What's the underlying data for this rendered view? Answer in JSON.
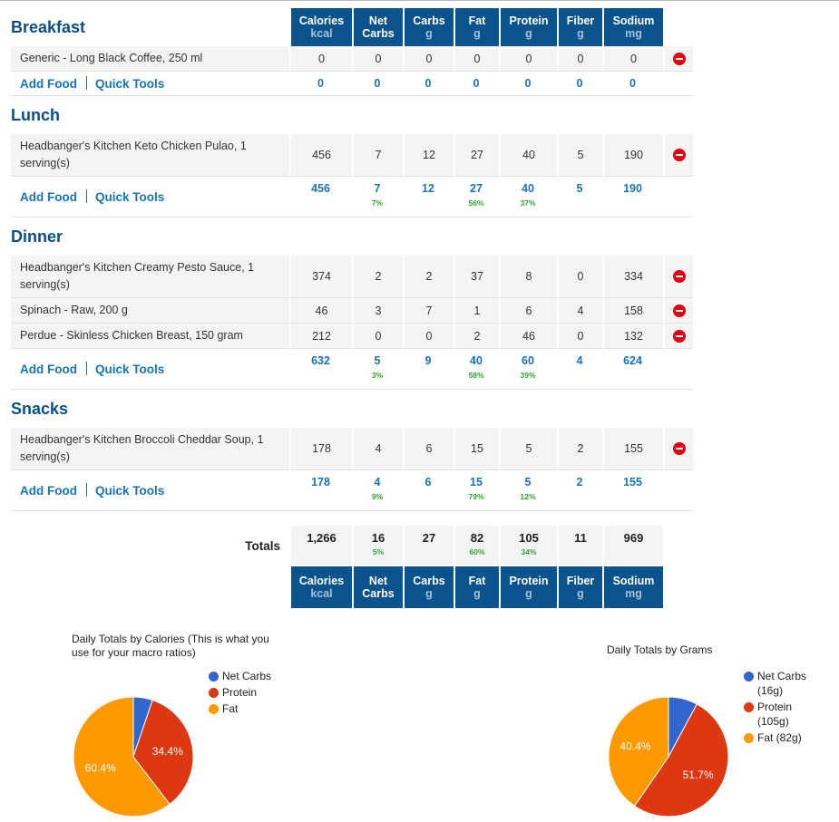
{
  "columns": [
    {
      "name": "Calories",
      "unit": "kcal"
    },
    {
      "name": "Net",
      "unit": "Carbs",
      "unit_style": "white"
    },
    {
      "name": "Carbs",
      "unit": "g"
    },
    {
      "name": "Fat",
      "unit": "g"
    },
    {
      "name": "Protein",
      "unit": "g"
    },
    {
      "name": "Fiber",
      "unit": "g"
    },
    {
      "name": "Sodium",
      "unit": "mg"
    }
  ],
  "links": {
    "add_food": "Add Food",
    "quick_tools": "Quick Tools"
  },
  "meals": [
    {
      "title": "Breakfast",
      "foods": [
        {
          "name": "Generic - Long Black Coffee, 250 ml",
          "values": [
            "0",
            "0",
            "0",
            "0",
            "0",
            "0",
            "0"
          ]
        }
      ],
      "totals": [
        "0",
        "0",
        "0",
        "0",
        "0",
        "0",
        "0"
      ],
      "percents": {
        "net": "",
        "fat": "",
        "protein": ""
      }
    },
    {
      "title": "Lunch",
      "foods": [
        {
          "name": "Headbanger's Kitchen Keto Chicken Pulao, 1 serving(s)",
          "values": [
            "456",
            "7",
            "12",
            "27",
            "40",
            "5",
            "190"
          ]
        }
      ],
      "totals": [
        "456",
        "7",
        "12",
        "27",
        "40",
        "5",
        "190"
      ],
      "percents": {
        "net": "7%",
        "fat": "56%",
        "protein": "37%"
      }
    },
    {
      "title": "Dinner",
      "foods": [
        {
          "name": "Headbanger's Kitchen Creamy Pesto Sauce, 1 serving(s)",
          "values": [
            "374",
            "2",
            "2",
            "37",
            "8",
            "0",
            "334"
          ]
        },
        {
          "name": "Spinach - Raw, 200 g",
          "values": [
            "46",
            "3",
            "7",
            "1",
            "6",
            "4",
            "158"
          ]
        },
        {
          "name": "Perdue - Skinless Chicken Breast, 150 gram",
          "values": [
            "212",
            "0",
            "0",
            "2",
            "46",
            "0",
            "132"
          ]
        }
      ],
      "totals": [
        "632",
        "5",
        "9",
        "40",
        "60",
        "4",
        "624"
      ],
      "percents": {
        "net": "3%",
        "fat": "58%",
        "protein": "39%"
      }
    },
    {
      "title": "Snacks",
      "foods": [
        {
          "name": "Headbanger's Kitchen Broccoli Cheddar Soup, 1 serving(s)",
          "values": [
            "178",
            "4",
            "6",
            "15",
            "5",
            "2",
            "155"
          ]
        }
      ],
      "totals": [
        "178",
        "4",
        "6",
        "15",
        "5",
        "2",
        "155"
      ],
      "percents": {
        "net": "9%",
        "fat": "79%",
        "protein": "12%"
      }
    }
  ],
  "daily_totals": {
    "label": "Totals",
    "values": [
      "1,266",
      "16",
      "27",
      "82",
      "105",
      "11",
      "969"
    ],
    "percents": {
      "net": "5%",
      "fat": "60%",
      "protein": "34%"
    }
  },
  "colors": {
    "header_blue": "#0a538d",
    "link_blue": "#1a73b8",
    "percent_green": "#2fa52f",
    "delete_red": "#e00010",
    "net_carbs": "#3366cc",
    "protein": "#dc3912",
    "fat": "#ff9900"
  },
  "chart_data": [
    {
      "type": "pie",
      "title": "Daily Totals by Calories (This is what you use for your macro ratios)",
      "legend_position": "right",
      "categories": [
        "Net Carbs",
        "Protein",
        "Fat"
      ],
      "legend_labels": [
        "Net Carbs",
        "Protein",
        "Fat"
      ],
      "values": [
        5.2,
        34.4,
        60.4
      ],
      "labels": [
        "",
        "34.4%",
        "60.4%"
      ],
      "colors": [
        "#3366cc",
        "#dc3912",
        "#ff9900"
      ]
    },
    {
      "type": "pie",
      "title": "Daily Totals by Grams",
      "legend_position": "right",
      "categories": [
        "Net Carbs",
        "Protein",
        "Fat"
      ],
      "legend_labels": [
        "Net Carbs (16g)",
        "Protein (105g)",
        "Fat (82g)"
      ],
      "values": [
        16,
        105,
        82
      ],
      "labels": [
        "",
        "51.7%",
        "40.4%"
      ],
      "colors": [
        "#3366cc",
        "#dc3912",
        "#ff9900"
      ]
    }
  ]
}
